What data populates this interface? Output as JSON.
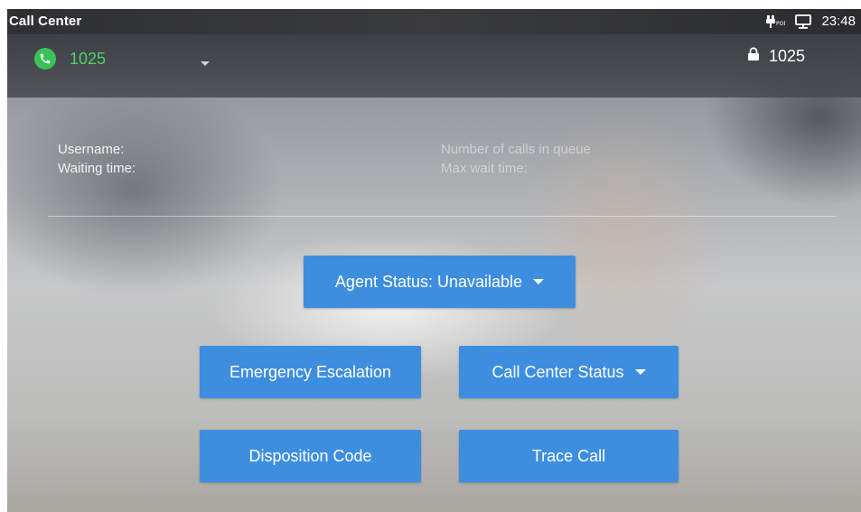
{
  "status_bar": {
    "app_title": "Call Center",
    "time": "23:48",
    "icons": [
      "poe-power-icon",
      "network-monitor-icon"
    ]
  },
  "account_bar": {
    "account_number": "1025",
    "line_number": "1025",
    "icons": [
      "phone-icon",
      "chevron-down-icon",
      "lock-icon"
    ]
  },
  "info": {
    "username_label": "Username:",
    "waiting_time_label": "Waiting time:",
    "calls_in_queue_label": "Number of calls in queue",
    "max_wait_time_label": "Max wait time:"
  },
  "buttons": {
    "agent_status": "Agent Status: Unavailable",
    "emergency_escalation": "Emergency Escalation",
    "call_center_status": "Call Center Status",
    "disposition_code": "Disposition Code",
    "trace_call": "Trace Call"
  },
  "colors": {
    "accent_button": "#3e8ee0",
    "account_green": "#4fd06c",
    "status_bar": "#2f3034"
  }
}
